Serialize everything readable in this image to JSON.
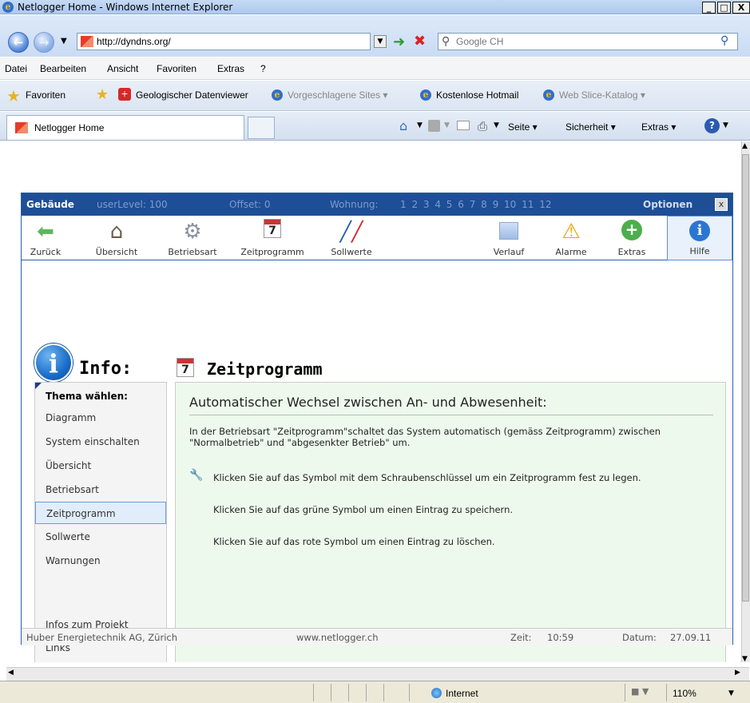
{
  "window": {
    "title": "Netlogger Home - Windows Internet Explorer",
    "min": "_",
    "max": "□",
    "close": "X"
  },
  "address": {
    "url": "http://dyndns.org/",
    "search_placeholder": "Google CH"
  },
  "menu": [
    "Datei",
    "Bearbeiten",
    "Ansicht",
    "Favoriten",
    "Extras",
    "?"
  ],
  "favorites": {
    "label": "Favoriten",
    "items": [
      "Geologischer Datenviewer",
      "Vorgeschlagene Sites ▾",
      "Kostenlose Hotmail",
      "Web Slice-Katalog ▾"
    ]
  },
  "tab": {
    "label": "Netlogger Home"
  },
  "commands": {
    "page": "Seite ▾",
    "security": "Sicherheit ▾",
    "extras": "Extras ▾"
  },
  "app": {
    "header": {
      "title": "Gebäude",
      "userlevel": "userLevel: 100",
      "offset": "Offset: 0",
      "wohnung": "Wohnung:",
      "numbers": "1 2 3 4 5 6 7 8 9 10 11 12",
      "options": "Optionen",
      "close": "x"
    },
    "toolbar": [
      "Zurück",
      "Übersicht",
      "Betriebsart",
      "Zeitprogramm",
      "Sollwerte",
      "Verlauf",
      "Alarme",
      "Extras",
      "Hilfe"
    ],
    "info_title": "Info:",
    "info_icon": "i",
    "cal_day": "7",
    "page_title": "Zeitprogramm",
    "sidebar": {
      "header": "Thema wählen:",
      "items": [
        "Diagramm",
        "System einschalten",
        "Übersicht",
        "Betriebsart",
        "Zeitprogramm",
        "Sollwerte",
        "Warnungen"
      ],
      "bottom": [
        "Infos zum Projekt",
        "Links"
      ]
    },
    "main": {
      "heading": "Automatischer Wechsel zwischen An- und Abwesenheit:",
      "para1": "In der Betriebsart \"Zeitprogramm\"schaltet das System automatisch (gemäss Zeitprogramm) zwischen \"Normalbetrieb\" und \"abgesenkter Betrieb\" um.",
      "para2": "Klicken Sie auf das Symbol mit dem Schraubenschlüssel um ein Zeitprogramm fest zu legen.",
      "para3": "Klicken Sie auf das grüne Symbol um einen Eintrag zu speichern.",
      "para4": "Klicken Sie auf das rote Symbol um einen Eintrag zu löschen."
    },
    "footer": {
      "company": "Huber Energietechnik AG, Zürich",
      "web": "www.netlogger.ch",
      "time_label": "Zeit:",
      "time": "10:59",
      "date_label": "Datum:",
      "date": "27.09.11"
    }
  },
  "status": {
    "zone": "Internet",
    "zoom": "110%"
  }
}
